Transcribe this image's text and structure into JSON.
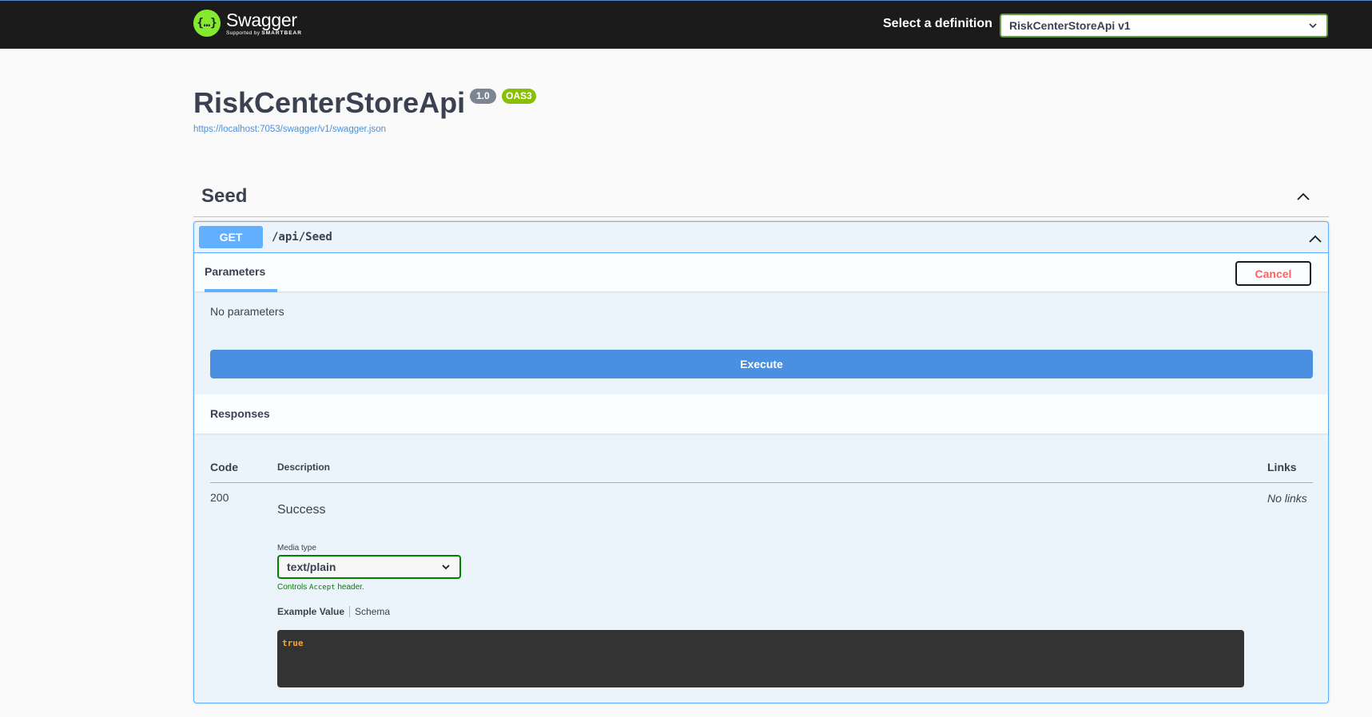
{
  "topbar": {
    "logo_icon": "{…}",
    "logo_name": "Swagger",
    "logo_sub_prefix": "Supported by",
    "logo_sub_brand": "SMARTBEAR",
    "definition_label": "Select a definition",
    "definition_value": "RiskCenterStoreApi v1"
  },
  "info": {
    "title": "RiskCenterStoreApi",
    "version": "1.0",
    "oas": "OAS3",
    "url": "https://localhost:7053/swagger/v1/swagger.json"
  },
  "tag": {
    "name": "Seed"
  },
  "operation": {
    "method": "GET",
    "path": "/api/Seed",
    "parameters_tab": "Parameters",
    "cancel_label": "Cancel",
    "no_parameters": "No parameters",
    "execute_label": "Execute",
    "responses_title": "Responses",
    "table": {
      "code_header": "Code",
      "description_header": "Description",
      "links_header": "Links"
    },
    "response": {
      "code": "200",
      "description": "Success",
      "links": "No links",
      "media_type_label": "Media type",
      "media_type_value": "text/plain",
      "controls_prefix": "Controls",
      "controls_code": "Accept",
      "controls_suffix": "header.",
      "example_tab": "Example Value",
      "schema_tab": "Schema",
      "example_body": "true"
    }
  },
  "colors": {
    "topbar_bg": "#1b1b1b",
    "get_blue": "#61affe",
    "execute_blue": "#4990e2",
    "cancel_red": "#ff6060",
    "oas_green": "#89bf04",
    "logo_green": "#85ea2d"
  }
}
